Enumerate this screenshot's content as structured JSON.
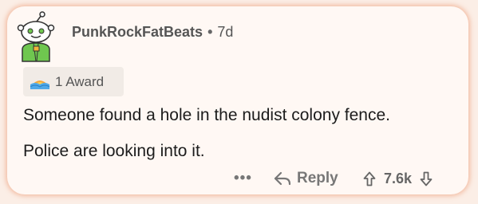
{
  "comment": {
    "author": "PunkRockFatBeats",
    "separator": "•",
    "age": "7d",
    "avatar_icon": "snoo-avatar-icon",
    "award": {
      "icon": "award-icon",
      "label": "1 Award"
    },
    "body": [
      "Someone found a hole in the nudist colony fence.",
      "Police are looking into it."
    ]
  },
  "actions": {
    "more_label": "•••",
    "reply_label": "Reply",
    "score": "7.6k",
    "reply_icon": "reply-arrow-icon",
    "upvote_icon": "upvote-icon",
    "downvote_icon": "downvote-icon"
  },
  "colors": {
    "background": "#fbeee6",
    "card": "#fff8f4",
    "glow": "#ed966e",
    "text": "#1c1c1c",
    "muted": "#555555",
    "avatar_green": "#6fc74f"
  }
}
